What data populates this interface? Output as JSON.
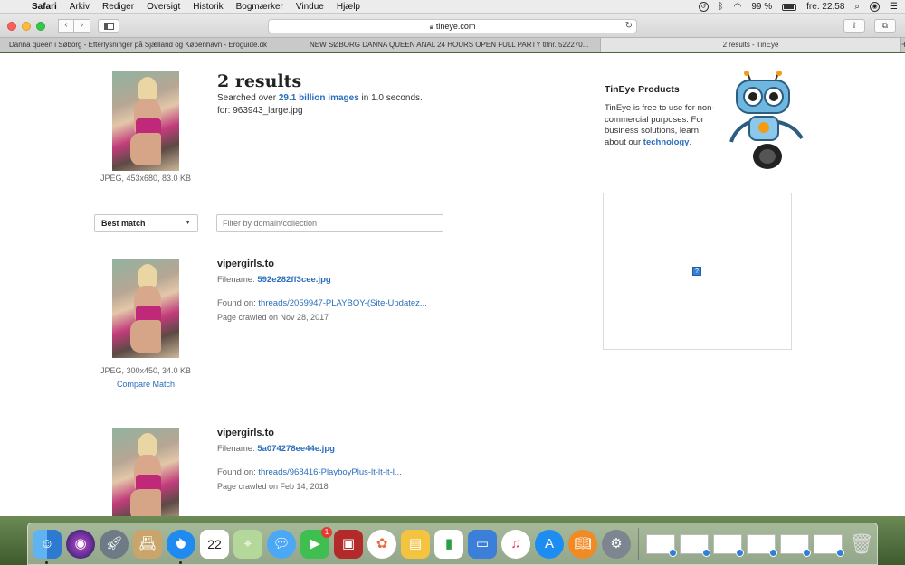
{
  "menubar": {
    "app_name": "Safari",
    "items": [
      "Arkiv",
      "Rediger",
      "Oversigt",
      "Historik",
      "Bogmærker",
      "Vindue",
      "Hjælp"
    ],
    "battery": "99 %",
    "clock": "fre. 22.58"
  },
  "toolbar": {
    "url": "tineye.com"
  },
  "tabs": [
    {
      "label": "Danna queen i Søborg - Efterlysninger på Sjælland og København - Eroguide.dk"
    },
    {
      "label": "NEW SØBORG DANNA QUEEN ANAL 24 HOURS OPEN FULL PARTY tlfnr. 522270..."
    },
    {
      "label": "2 results - TinEye"
    }
  ],
  "query": {
    "meta": "JPEG, 453x680, 83.0 KB",
    "title": "2 results",
    "searched_prefix": "Searched over ",
    "searched_count": "29.1 billion images",
    "searched_suffix": " in 1.0 seconds.",
    "for_file": "for: 963943_large.jpg"
  },
  "controls": {
    "sort_label": "Best match",
    "filter_placeholder": "Filter by domain/collection"
  },
  "results": [
    {
      "domain": "vipergirls.to",
      "filename_label": "Filename: ",
      "filename": "592e282ff3cee.jpg",
      "found_label": "Found on: ",
      "found_on": "threads/2059947-PLAYBOY-(Site-Updatez...",
      "crawled": "Page crawled on Nov 28, 2017",
      "meta": "JPEG, 300x450, 34.0 KB",
      "compare": "Compare Match"
    },
    {
      "domain": "vipergirls.to",
      "filename_label": "Filename: ",
      "filename": "5a074278ee44e.jpg",
      "found_label": "Found on: ",
      "found_on": "threads/968416-PlayboyPlus-lt-lt-lt-l...",
      "crawled": "Page crawled on Feb 14, 2018"
    }
  ],
  "sidebar": {
    "title": "TinEye Products",
    "text": "TinEye is free to use for non-commercial purposes. For business solutions, learn about our ",
    "link": "technology",
    "text_end": "."
  },
  "dock": {
    "calendar_day": "22",
    "facetime_badge": "1",
    "icons": [
      "finder-icon",
      "siri-icon",
      "launchpad-icon",
      "contacts-icon",
      "safari-icon",
      "calendar-icon",
      "maps-icon",
      "messages-icon",
      "facetime-icon",
      "photobooth-icon",
      "photos-icon",
      "keynote-icon",
      "numbers-icon",
      "presentation-icon",
      "music-icon",
      "appstore-icon",
      "books-icon",
      "system-preferences-icon",
      "trash-icon"
    ]
  }
}
